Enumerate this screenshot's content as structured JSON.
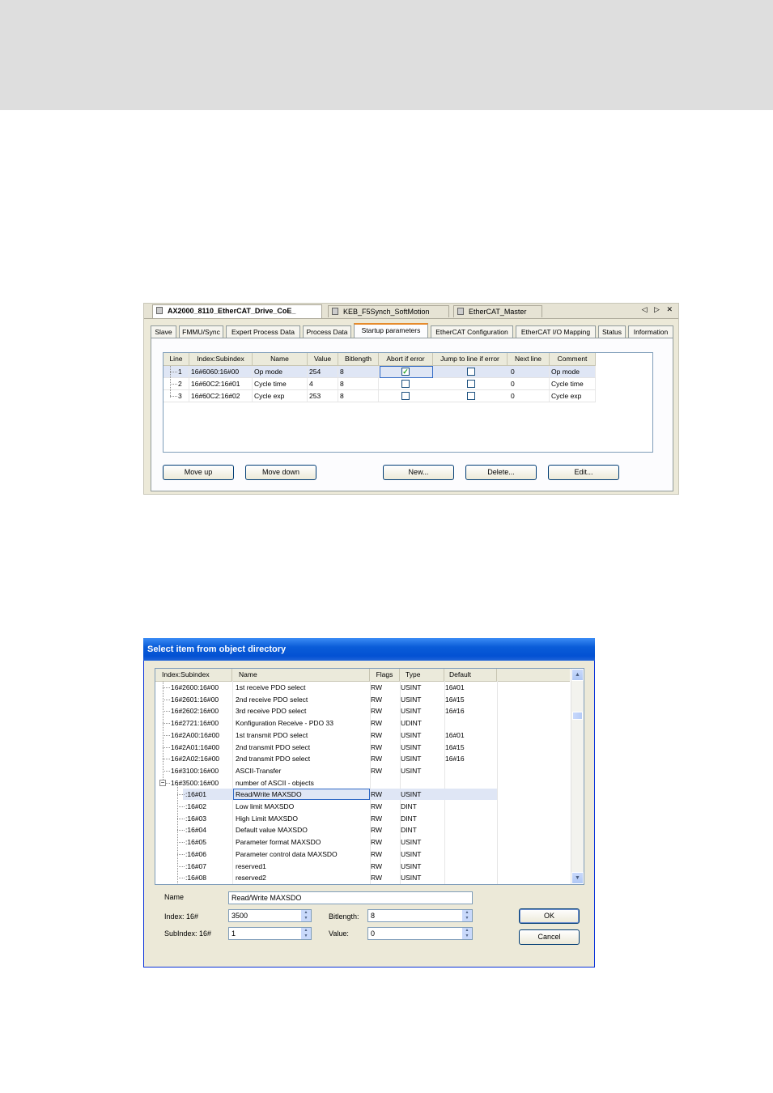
{
  "shot1": {
    "doc_tabs": [
      {
        "label": "AX2000_8110_EtherCAT_Drive_CoE_",
        "active": true
      },
      {
        "label": "KEB_F5Synch_SoftMotion",
        "active": false
      },
      {
        "label": "EtherCAT_Master",
        "active": false
      }
    ],
    "nav_buttons": "◁ ▷ ✕",
    "sub_tabs": [
      "Slave",
      "FMMU/Sync",
      "Expert Process Data",
      "Process Data",
      "Startup parameters",
      "EtherCAT Configuration",
      "EtherCAT I/O Mapping",
      "Status",
      "Information"
    ],
    "active_sub_tab": "Startup parameters",
    "grid": {
      "columns": [
        "Line",
        "Index:Subindex",
        "Name",
        "Value",
        "Bitlength",
        "Abort if error",
        "Jump to line if error",
        "Next line",
        "Comment"
      ],
      "rows": [
        {
          "line": "1",
          "index": "16#6060:16#00",
          "name": "Op mode",
          "value": "254",
          "bitlength": "8",
          "abort": true,
          "jump": false,
          "next": "0",
          "comment": "Op mode"
        },
        {
          "line": "2",
          "index": "16#60C2:16#01",
          "name": "Cycle time",
          "value": "4",
          "bitlength": "8",
          "abort": false,
          "jump": false,
          "next": "0",
          "comment": "Cycle time"
        },
        {
          "line": "3",
          "index": "16#60C2:16#02",
          "name": "Cycle exp",
          "value": "253",
          "bitlength": "8",
          "abort": false,
          "jump": false,
          "next": "0",
          "comment": "Cycle exp"
        }
      ]
    },
    "buttons": {
      "move_up": "Move up",
      "move_down": "Move down",
      "new": "New...",
      "delete": "Delete...",
      "edit": "Edit..."
    }
  },
  "shot2": {
    "title": "Select item from object directory",
    "grid": {
      "columns": [
        "Index:Subindex",
        "Name",
        "Flags",
        "Type",
        "Default"
      ],
      "rows": [
        {
          "index": "16#2600:16#00",
          "name": "1st receive PDO select",
          "flags": "RW",
          "type": "USINT",
          "default": "16#01",
          "level": 0
        },
        {
          "index": "16#2601:16#00",
          "name": "2nd receive PDO select",
          "flags": "RW",
          "type": "USINT",
          "default": "16#15",
          "level": 0
        },
        {
          "index": "16#2602:16#00",
          "name": "3rd receive PDO select",
          "flags": "RW",
          "type": "USINT",
          "default": "16#16",
          "level": 0
        },
        {
          "index": "16#2721:16#00",
          "name": "Konfiguration Receive - PDO 33",
          "flags": "RW",
          "type": "UDINT",
          "default": "",
          "level": 0
        },
        {
          "index": "16#2A00:16#00",
          "name": "1st transmit PDO select",
          "flags": "RW",
          "type": "USINT",
          "default": "16#01",
          "level": 0
        },
        {
          "index": "16#2A01:16#00",
          "name": "2nd transmit PDO select",
          "flags": "RW",
          "type": "USINT",
          "default": "16#15",
          "level": 0
        },
        {
          "index": "16#2A02:16#00",
          "name": "2nd transmit PDO select",
          "flags": "RW",
          "type": "USINT",
          "default": "16#16",
          "level": 0
        },
        {
          "index": "16#3100:16#00",
          "name": "ASCII-Transfer",
          "flags": "RW",
          "type": "USINT",
          "default": "",
          "level": 0
        },
        {
          "index": "16#3500:16#00",
          "name": "number of ASCII - objects",
          "flags": "",
          "type": "",
          "default": "",
          "level": 0,
          "expanded": true
        },
        {
          "index": ":16#01",
          "name": "Read/Write MAXSDO",
          "flags": "RW",
          "type": "USINT",
          "default": "",
          "level": 1,
          "selected": true
        },
        {
          "index": ":16#02",
          "name": "Low limit MAXSDO",
          "flags": "RW",
          "type": "DINT",
          "default": "",
          "level": 1
        },
        {
          "index": ":16#03",
          "name": "High Limit MAXSDO",
          "flags": "RW",
          "type": "DINT",
          "default": "",
          "level": 1
        },
        {
          "index": ":16#04",
          "name": "Default value MAXSDO",
          "flags": "RW",
          "type": "DINT",
          "default": "",
          "level": 1
        },
        {
          "index": ":16#05",
          "name": "Parameter format MAXSDO",
          "flags": "RW",
          "type": "USINT",
          "default": "",
          "level": 1
        },
        {
          "index": ":16#06",
          "name": "Parameter control data MAXSDO",
          "flags": "RW",
          "type": "USINT",
          "default": "",
          "level": 1
        },
        {
          "index": ":16#07",
          "name": "reserved1",
          "flags": "RW",
          "type": "USINT",
          "default": "",
          "level": 1
        },
        {
          "index": ":16#08",
          "name": "reserved2",
          "flags": "RW",
          "type": "USINT",
          "default": "",
          "level": 1
        }
      ]
    },
    "form": {
      "name_label": "Name",
      "name_value": "Read/Write MAXSDO",
      "index_label": "Index: 16#",
      "index_value": "3500",
      "subindex_label": "SubIndex: 16#",
      "subindex_value": "1",
      "bitlength_label": "Bitlength:",
      "bitlength_value": "8",
      "value_label": "Value:",
      "value_value": "0"
    },
    "buttons": {
      "ok": "OK",
      "cancel": "Cancel"
    }
  }
}
